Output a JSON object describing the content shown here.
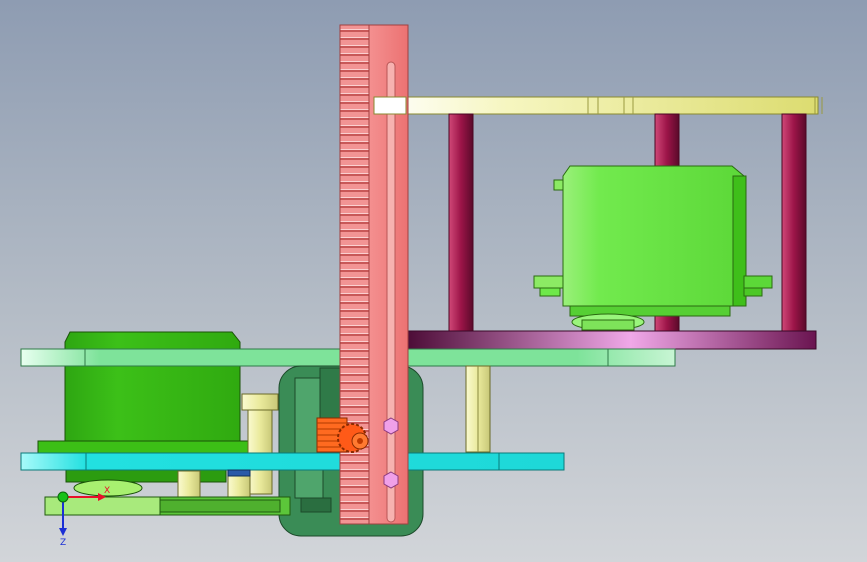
{
  "viewport": {
    "background_top": "#8e9cb2",
    "background_bottom": "#d2d5d9"
  },
  "triad": {
    "x_label": "X",
    "z_label": "Z",
    "x_color": "#e8102a",
    "y_color": "#18c018",
    "z_color": "#1b2fd6"
  },
  "colors": {
    "rack": "#f07a78",
    "rack_teeth": "#f4a0a0",
    "upper_bracket": "#f0f08a",
    "posts": "#a01a4a",
    "lower_bracket": "#8a1e64",
    "servo": "#6ee84a",
    "servo_dark": "#3fbf1a",
    "main_plate": "#7ee39a",
    "cyan_plate": "#28dede",
    "housing": "#3a8c56",
    "pinion_gear": "#ff5a18",
    "base_plate": "#5cc63a"
  }
}
